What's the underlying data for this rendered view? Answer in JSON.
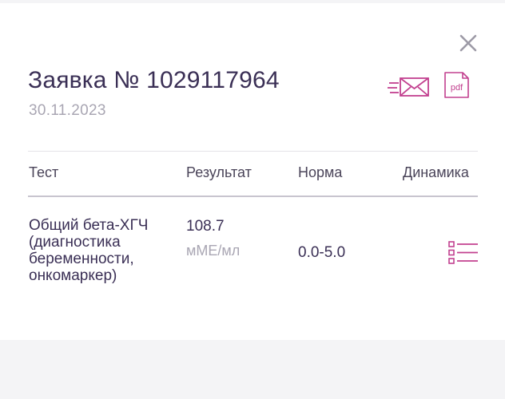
{
  "order": {
    "title": "Заявка № 1029117964",
    "date": "30.11.2023"
  },
  "actions": {
    "mail_icon": "envelope-send-icon",
    "pdf_label": "pdf",
    "close_icon": "close-icon"
  },
  "table": {
    "headers": [
      "Тест",
      "Результат",
      "Норма",
      "Динамика"
    ],
    "rows": [
      {
        "test": "Общий бета-ХГЧ (диагностика беременности, онкомаркер)",
        "result": "108.7",
        "unit": "мМЕ/мл",
        "norm": "0.0-5.0",
        "dynamics_icon": "list-icon"
      }
    ]
  },
  "colors": {
    "accent": "#c2408f",
    "title_text": "#3a2f55",
    "muted_text": "#a9a6b3",
    "background": "#f4f4f6"
  }
}
